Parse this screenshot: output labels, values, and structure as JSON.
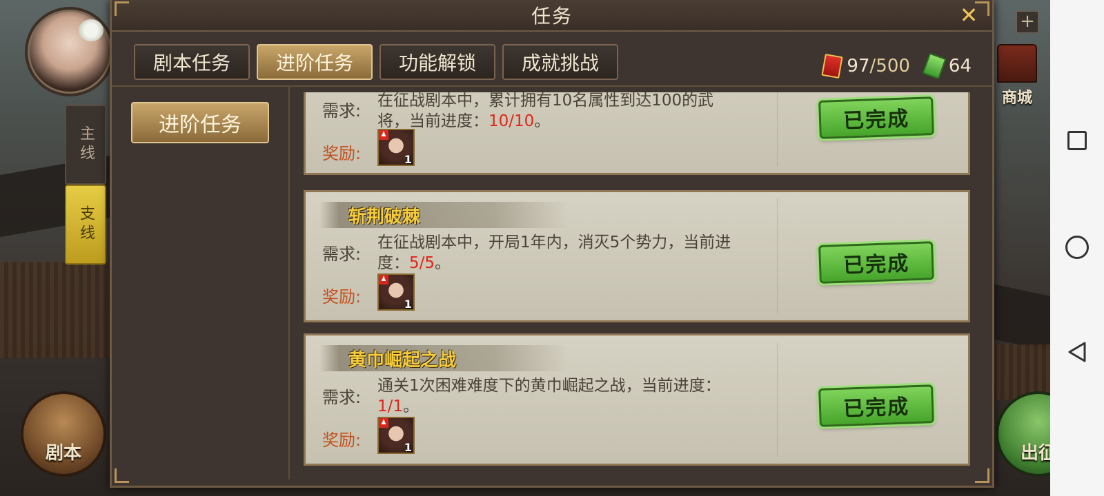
{
  "dialog": {
    "title": "任务"
  },
  "tabs": [
    {
      "label": "剧本任务"
    },
    {
      "label": "进阶任务",
      "active": true
    },
    {
      "label": "功能解锁"
    },
    {
      "label": "成就挑战"
    }
  ],
  "currency": {
    "tokens_current": "97",
    "tokens_total": "/500",
    "jade": "64"
  },
  "sub_tab": {
    "label": "进阶任务"
  },
  "labels": {
    "requirement": "需求:",
    "reward": "奖励:",
    "completed": "已完成"
  },
  "tasks": [
    {
      "title": "",
      "requirement_text": "在征战剧本中，累计拥有10名属性到达100的武将，当前进度：",
      "progress": "10/10",
      "tail": "。",
      "reward_qty": "1"
    },
    {
      "title": "斩荆破棘",
      "requirement_text": "在征战剧本中，开局1年内，消灭5个势力，当前进度：",
      "progress": "5/5",
      "tail": "。",
      "reward_qty": "1"
    },
    {
      "title": "黄巾崛起之战",
      "requirement_text": "通关1次困难难度下的黄巾崛起之战，当前进度：",
      "progress": "1/1",
      "tail": "。",
      "reward_qty": "1"
    }
  ],
  "side": {
    "main": "主线",
    "branch": "支线"
  },
  "hud": {
    "script_button": "剧本",
    "march_button": "出征",
    "shop": "商城",
    "plus": "+"
  },
  "close": "✕",
  "colors": {
    "progress": "#e0251c",
    "title_gold": "#f5cc3c",
    "stamp_green": "#5cbf3a"
  }
}
